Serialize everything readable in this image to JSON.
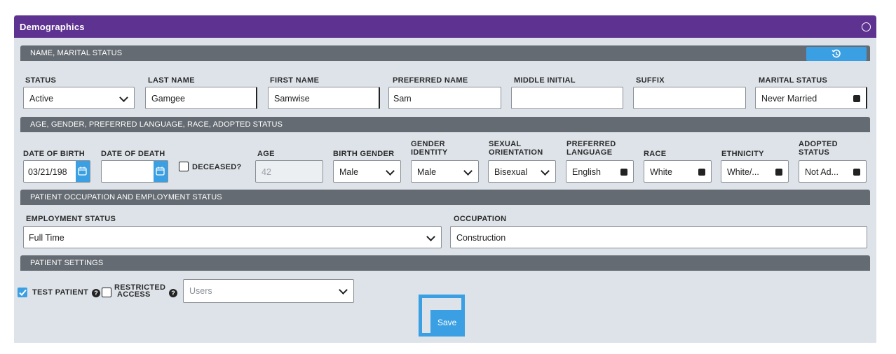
{
  "window": {
    "title": "Demographics"
  },
  "sections": {
    "name": "NAME, MARITAL STATUS",
    "age": "AGE, GENDER, PREFERRED LANGUAGE, RACE, ADOPTED STATUS",
    "employment": "PATIENT OCCUPATION AND EMPLOYMENT STATUS",
    "settings": "PATIENT SETTINGS"
  },
  "name_fields": {
    "status": {
      "label": "STATUS",
      "value": "Active"
    },
    "last_name": {
      "label": "LAST NAME",
      "value": "Gamgee"
    },
    "first_name": {
      "label": "FIRST NAME",
      "value": "Samwise"
    },
    "preferred_name": {
      "label": "PREFERRED NAME",
      "value": "Sam"
    },
    "middle_initial": {
      "label": "MIDDLE INITIAL",
      "value": ""
    },
    "suffix": {
      "label": "SUFFIX",
      "value": ""
    },
    "marital_status": {
      "label": "MARITAL STATUS",
      "value": "Never Married"
    }
  },
  "age_fields": {
    "dob": {
      "label": "DATE OF BIRTH",
      "value": "03/21/198"
    },
    "dod": {
      "label": "DATE OF DEATH",
      "value": ""
    },
    "deceased": {
      "label": "DECEASED?",
      "checked": false
    },
    "age": {
      "label": "AGE",
      "value": "42"
    },
    "birth_gender": {
      "label": "BIRTH GENDER",
      "value": "Male"
    },
    "gender_identity": {
      "label1": "GENDER",
      "label2": "IDENTITY",
      "value": "Male"
    },
    "sexual_orientation": {
      "label1": "SEXUAL",
      "label2": "ORIENTATION",
      "value": "Bisexual"
    },
    "preferred_language": {
      "label1": "PREFERRED",
      "label2": "LANGUAGE",
      "value": "English"
    },
    "race": {
      "label": "RACE",
      "value": "White"
    },
    "ethnicity": {
      "label": "ETHNICITY",
      "value": "White/..."
    },
    "adopted_status": {
      "label1": "ADOPTED",
      "label2": "STATUS",
      "value": "Not Ad..."
    }
  },
  "employment_fields": {
    "status": {
      "label": "EMPLOYMENT STATUS",
      "value": "Full Time"
    },
    "occupation": {
      "label": "OCCUPATION",
      "value": "Construction"
    }
  },
  "settings_fields": {
    "test_patient": {
      "label": "TEST PATIENT",
      "checked": true
    },
    "restricted_access": {
      "label1": "RESTRICTED",
      "label2": "ACCESS",
      "checked": false
    },
    "users": {
      "placeholder": "Users"
    }
  },
  "actions": {
    "save_label": "Save"
  },
  "colors": {
    "titlebar": "#5e3291",
    "section": "#646b72",
    "accent": "#3aa0e3",
    "panel": "#dde3e9"
  },
  "icons": [
    "history-icon",
    "calendar-icon",
    "chevron-down-icon",
    "help-icon",
    "check-icon",
    "circle-icon"
  ]
}
